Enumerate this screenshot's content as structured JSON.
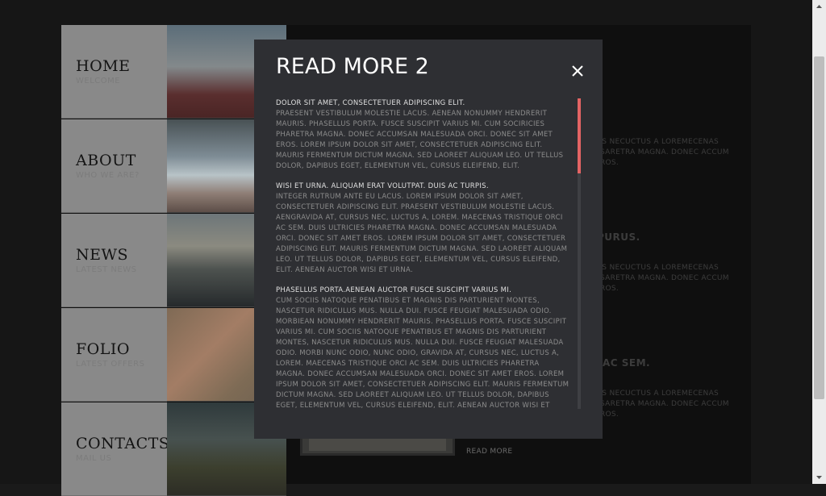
{
  "nav": {
    "items": [
      {
        "title": "HOME",
        "subtitle": "WELCOME"
      },
      {
        "title": "ABOUT",
        "subtitle": "WHO WE ARE?"
      },
      {
        "title": "NEWS",
        "subtitle": "LATEST NEWS"
      },
      {
        "title": "FOLIO",
        "subtitle": "LATEST OFFERS"
      },
      {
        "title": "CONTACTS",
        "subtitle": "MAIL US"
      }
    ]
  },
  "background": {
    "block1_text": "LIS NECUCTUS A LOREMECENAS\nESARETRA MAGNA. DONEC ACCUM\nEROS.",
    "block2_heading": "PURUS.",
    "block2_text": "LIS NECUCTUS A LOREMECENAS\nESARETRA MAGNA. DONEC ACCUM\nEROS.",
    "block3_heading": "AC SEM.",
    "block3_text": "LIS NECUCTUS A LOREMECENAS\nESARETRA MAGNA. DONEC ACCUM\nEROS.",
    "read_more": "READ MORE"
  },
  "modal": {
    "title": "READ MORE 2",
    "paragraphs": [
      {
        "heading": "DOLOR SIT AMET, CONSECTETUER ADIPISCING ELIT.",
        "text": "PRAESENT VESTIBULUM MOLESTIE LACUS. AENEAN NONUMMY HENDRERIT MAURIS. PHASELLUS PORTA. FUSCE SUSCIPIT VARIUS MI. CUM SOCIRICIES PHARETRA MAGNA. DONEC ACCUMSAN MALESUADA ORCI. DONEC SIT AMET EROS. LOREM IPSUM DOLOR SIT AMET, CONSECTETUER ADIPISCING ELIT. MAURIS FERMENTUM DICTUM MAGNA. SED LAOREET ALIQUAM LEO. UT TELLUS DOLOR, DAPIBUS EGET, ELEMENTUM VEL, CURSUS ELEIFEND, ELIT."
      },
      {
        "heading": "WISI ET URNA. ALIQUAM ERAT VOLUTPAT. DUIS AC TURPIS.",
        "text": "INTEGER RUTRUM ANTE EU LACUS. LOREM IPSUM DOLOR SIT AMET, CONSECTETUER ADIPISCING ELIT. PRAESENT VESTIBULUM MOLESTIE LACUS. AENGRAVIDA AT, CURSUS NEC, LUCTUS A, LOREM. MAECENAS TRISTIQUE ORCI AC SEM. DUIS ULTRICIES PHARETRA MAGNA. DONEC ACCUMSAN MALESUADA ORCI. DONEC SIT AMET EROS. LOREM IPSUM DOLOR SIT AMET, CONSECTETUER ADIPISCING ELIT. MAURIS FERMENTUM DICTUM MAGNA. SED LAOREET ALIQUAM LEO. UT TELLUS DOLOR, DAPIBUS EGET, ELEMENTUM VEL, CURSUS ELEIFEND, ELIT. AENEAN AUCTOR WISI ET URNA."
      },
      {
        "heading": "PHASELLUS PORTA.AENEAN AUCTOR FUSCE SUSCIPIT VARIUS MI.",
        "text": "CUM SOCIIS NATOQUE PENATIBUS ET MAGNIS DIS PARTURIENT MONTES, NASCETUR RIDICULUS MUS. NULLA DUI. FUSCE FEUGIAT MALESUADA ODIO. MORBIEAN NONUMMY HENDRERIT MAURIS. PHASELLUS PORTA. FUSCE SUSCIPIT VARIUS MI. CUM SOCIIS NATOQUE PENATIBUS ET MAGNIS DIS PARTURIENT MONTES, NASCETUR RIDICULUS MUS. NULLA DUI. FUSCE FEUGIAT MALESUADA ODIO. MORBI NUNC ODIO, NUNC ODIO, GRAVIDA AT, CURSUS NEC, LUCTUS A, LOREM. MAECENAS TRISTIQUE ORCI AC SEM. DUIS ULTRICIES PHARETRA MAGNA. DONEC ACCUMSAN MALESUADA ORCI. DONEC SIT AMET EROS. LOREM IPSUM DOLOR SIT AMET, CONSECTETUER ADIPISCING ELIT. MAURIS FERMENTUM DICTUM MAGNA. SED LAOREET ALIQUAM LEO. UT TELLUS DOLOR, DAPIBUS EGET, ELEMENTUM VEL, CURSUS ELEIFEND, ELIT. AENEAN AUCTOR WISI ET URNA."
      }
    ],
    "scroll_fraction": 0.24
  },
  "icons": {
    "close": "close-icon",
    "scroll_up": "chevron-up-icon",
    "scroll_down": "chevron-down-icon"
  },
  "colors": {
    "accent": "#e36464",
    "modal_bg": "#2e2f33",
    "nav_bg": "#898989"
  }
}
